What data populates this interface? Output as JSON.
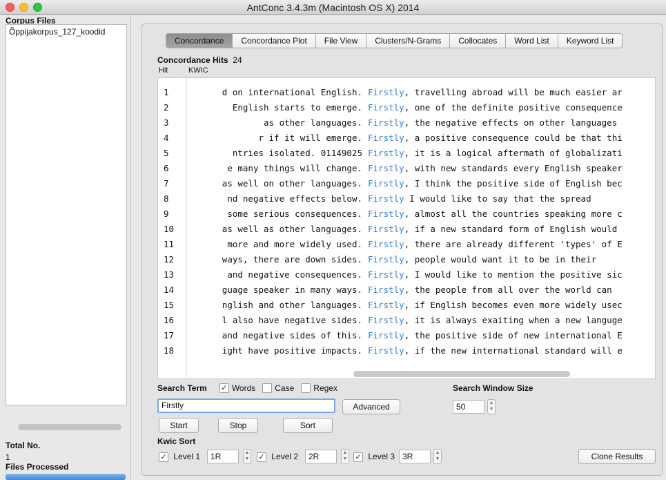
{
  "window": {
    "title": "AntConc 3.4.3m (Macintosh OS X) 2014"
  },
  "sidebar": {
    "corpus_files_label": "Corpus Files",
    "files": [
      "Õppijakorpus_127_koodid"
    ],
    "total_no_label": "Total No.",
    "total_no_value": "1",
    "files_processed_label": "Files Processed"
  },
  "tabs": [
    {
      "label": "Concordance",
      "active": true
    },
    {
      "label": "Concordance Plot"
    },
    {
      "label": "File View"
    },
    {
      "label": "Clusters/N-Grams"
    },
    {
      "label": "Collocates"
    },
    {
      "label": "Word List"
    },
    {
      "label": "Keyword List"
    }
  ],
  "concordance": {
    "hits_label": "Concordance Hits",
    "hits_count": "24",
    "col_hit": "Hit",
    "col_kwic": "KWIC",
    "keyword": "Firstly",
    "rows": [
      {
        "num": "1",
        "left": "d on international English.",
        "kw": "Firstly",
        "right": ", travelling abroad will be much easier ar"
      },
      {
        "num": "2",
        "left": "English starts to emerge.",
        "kw": "Firstly",
        "right": ", one of the definite positive consequence"
      },
      {
        "num": "3",
        "left": "as other languages.",
        "kw": "Firstly",
        "right": ", the negative effects on other languages"
      },
      {
        "num": "4",
        "left": "r if it will emerge.",
        "kw": "Firstly",
        "right": ", a positive consequence could be that thi"
      },
      {
        "num": "5",
        "left": "ntries isolated.  01149025",
        "kw": "Firstly",
        "right": ", it is a logical aftermath of globalizati"
      },
      {
        "num": "6",
        "left": "e many things will change.",
        "kw": "Firstly",
        "right": ", with new standards every English speaker"
      },
      {
        "num": "7",
        "left": "as well on other languages.",
        "kw": "Firstly",
        "right": ", I think the positive side of English bec"
      },
      {
        "num": "8",
        "left": "nd negative effects below.",
        "kw": "Firstly",
        "right": " I would like to say that the spread"
      },
      {
        "num": "9",
        "left": "some serious consequences.",
        "kw": "Firstly",
        "right": ", almost all the countries speaking more c"
      },
      {
        "num": "10",
        "left": "as well as other languages.",
        "kw": "Firstly",
        "right": ", if a new standard form of English would"
      },
      {
        "num": "11",
        "left": "more and more widely used.",
        "kw": "Firstly",
        "right": ", there are already different 'types' of E"
      },
      {
        "num": "12",
        "left": "ways, there are down sides.",
        "kw": "Firstly",
        "right": ", people would want it to be in their"
      },
      {
        "num": "13",
        "left": "and negative consequences.",
        "kw": "Firstly",
        "right": ", I would like to mention the positive sic"
      },
      {
        "num": "14",
        "left": "guage speaker in many ways.",
        "kw": "Firstly",
        "right": ", the people from all over the world can"
      },
      {
        "num": "15",
        "left": "nglish and other languages.",
        "kw": "Firstly",
        "right": ", if English becomes even more widely usec"
      },
      {
        "num": "16",
        "left": "l also have negative sides.",
        "kw": "Firstly",
        "right": ", it is always exaiting when a new languge"
      },
      {
        "num": "17",
        "left": "and negative sides of this.",
        "kw": "Firstly",
        "right": ", the positive side of new international E"
      },
      {
        "num": "18",
        "left": "ight have positive impacts.",
        "kw": "Firstly",
        "right": ", if the new international standard will e"
      }
    ]
  },
  "search": {
    "term_label": "Search Term",
    "words_label": "Words",
    "case_label": "Case",
    "regex_label": "Regex",
    "value": "Firstly",
    "advanced_label": "Advanced",
    "window_size_label": "Search Window Size",
    "window_size_value": "50",
    "start_label": "Start",
    "stop_label": "Stop",
    "sort_label": "Sort"
  },
  "kwic_sort": {
    "label": "Kwic Sort",
    "level1_label": "Level 1",
    "level1_value": "1R",
    "level2_label": "Level 2",
    "level2_value": "2R",
    "level3_label": "Level 3",
    "level3_value": "3R",
    "clone_label": "Clone Results"
  },
  "colors": {
    "keyword": "#3a7fd0",
    "active_tab": "#9a9a9a",
    "progress": "#3d89d8"
  }
}
